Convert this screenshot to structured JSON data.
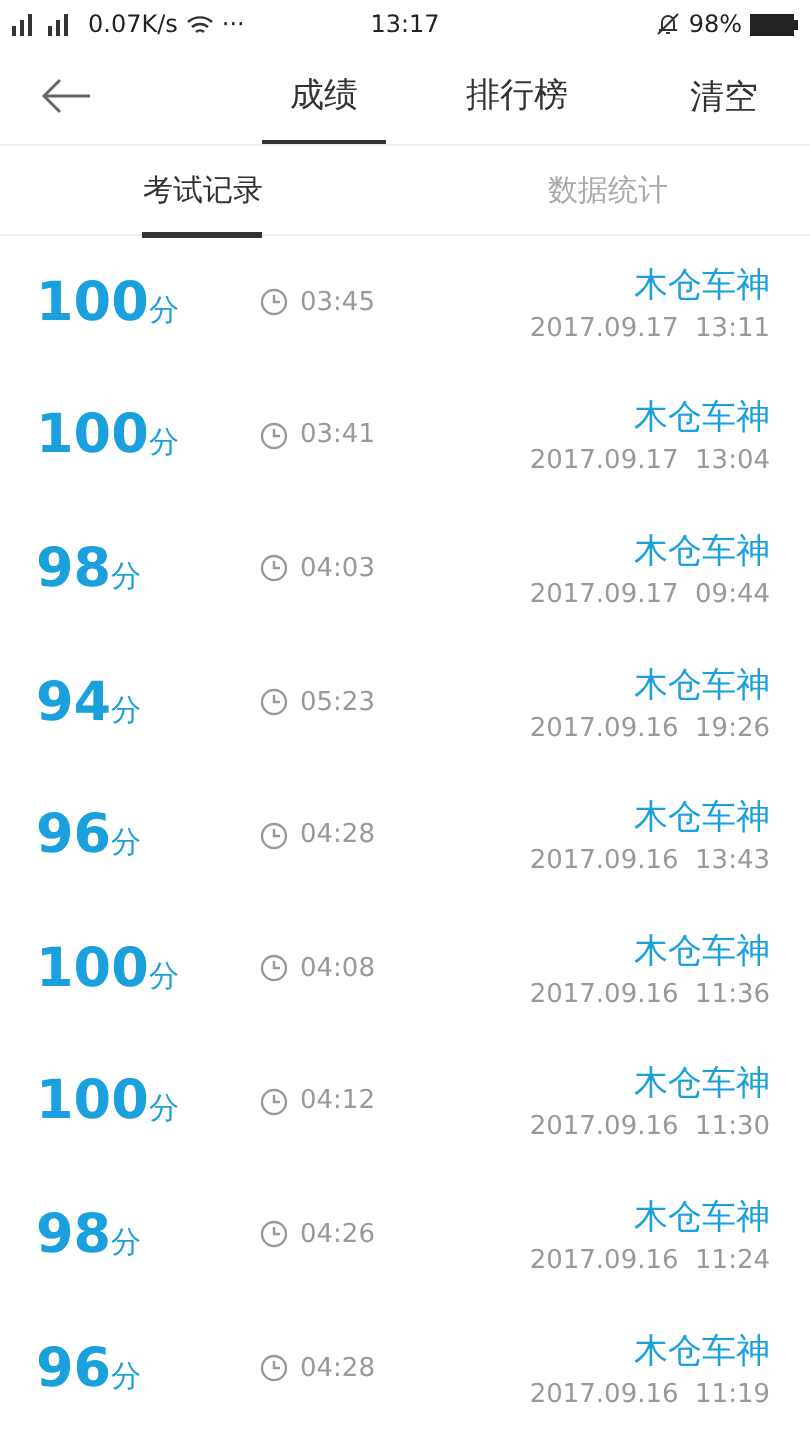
{
  "status_bar": {
    "speed": "0.07K/s",
    "more": "···",
    "time": "13:17",
    "battery": "98%"
  },
  "header": {
    "tabs": [
      {
        "label": "成绩",
        "selected": true
      },
      {
        "label": "排行榜",
        "selected": false
      }
    ],
    "action": "清空"
  },
  "sub_tabs": [
    {
      "label": "考试记录",
      "selected": true
    },
    {
      "label": "数据统计",
      "selected": false
    }
  ],
  "records": [
    {
      "score": "100",
      "unit": "分",
      "duration": "03:45",
      "name": "木仓车神",
      "date": "2017.09.17  13:11"
    },
    {
      "score": "100",
      "unit": "分",
      "duration": "03:41",
      "name": "木仓车神",
      "date": "2017.09.17  13:04"
    },
    {
      "score": "98",
      "unit": "分",
      "duration": "04:03",
      "name": "木仓车神",
      "date": "2017.09.17  09:44"
    },
    {
      "score": "94",
      "unit": "分",
      "duration": "05:23",
      "name": "木仓车神",
      "date": "2017.09.16  19:26"
    },
    {
      "score": "96",
      "unit": "分",
      "duration": "04:28",
      "name": "木仓车神",
      "date": "2017.09.16  13:43"
    },
    {
      "score": "100",
      "unit": "分",
      "duration": "04:08",
      "name": "木仓车神",
      "date": "2017.09.16  11:36"
    },
    {
      "score": "100",
      "unit": "分",
      "duration": "04:12",
      "name": "木仓车神",
      "date": "2017.09.16  11:30"
    },
    {
      "score": "98",
      "unit": "分",
      "duration": "04:26",
      "name": "木仓车神",
      "date": "2017.09.16  11:24"
    },
    {
      "score": "96",
      "unit": "分",
      "duration": "04:28",
      "name": "木仓车神",
      "date": "2017.09.16  11:19"
    }
  ]
}
